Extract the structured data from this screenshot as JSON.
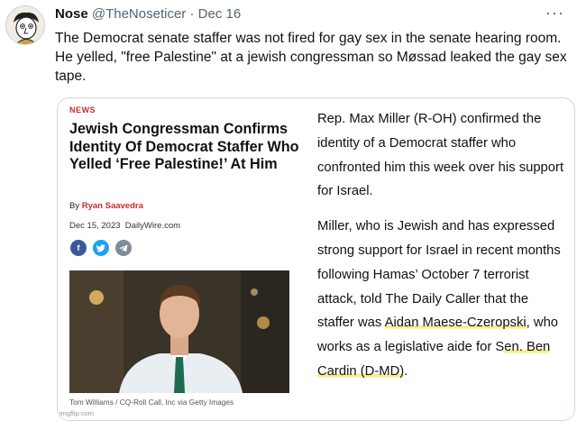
{
  "tweet": {
    "display_name": "Nose",
    "handle": "@TheNoseticer",
    "separator": "·",
    "date": "Dec 16",
    "more_label": "···",
    "text": "The Democrat senate staffer was not fired for gay sex in the senate hearing room. He yelled, \"free Palestine\" at a jewish congressman so Møssad leaked the gay sex tape."
  },
  "article": {
    "label": "NEWS",
    "headline": "Jewish Congressman Confirms Identity Of Democrat Staffer Who Yelled ‘Free Palestine!’ At Him",
    "by_prefix": "By",
    "author": "Ryan Saavedra",
    "date": "Dec 15, 2023",
    "source": "DailyWire.com",
    "share_icons": [
      "facebook-icon",
      "twitter-icon",
      "telegram-icon"
    ],
    "photo_caption": "Tom Williams / CQ-Roll Call, Inc via Getty Images",
    "watermark": "imgflip.com",
    "body_p1": "Rep. Max Miller (R-OH) confirmed the identity of a Democrat staffer who confronted him this week over his support for Israel.",
    "body_p2_a": "Miller, who is Jewish and has expressed strong support for Israel in recent months following Hamas’ October 7 terrorist attack, told The Daily Caller that the staffer was ",
    "body_p2_hl1": "Aidan Maese-Czeropski",
    "body_p2_b": ", who works as a legislative aide for S",
    "body_p2_hl2": "en. Ben Cardin (D-MD)",
    "body_p2_c": "."
  },
  "colors": {
    "accent_red": "#c4302b",
    "highlight": "#f5ef86",
    "muted": "#536471"
  }
}
